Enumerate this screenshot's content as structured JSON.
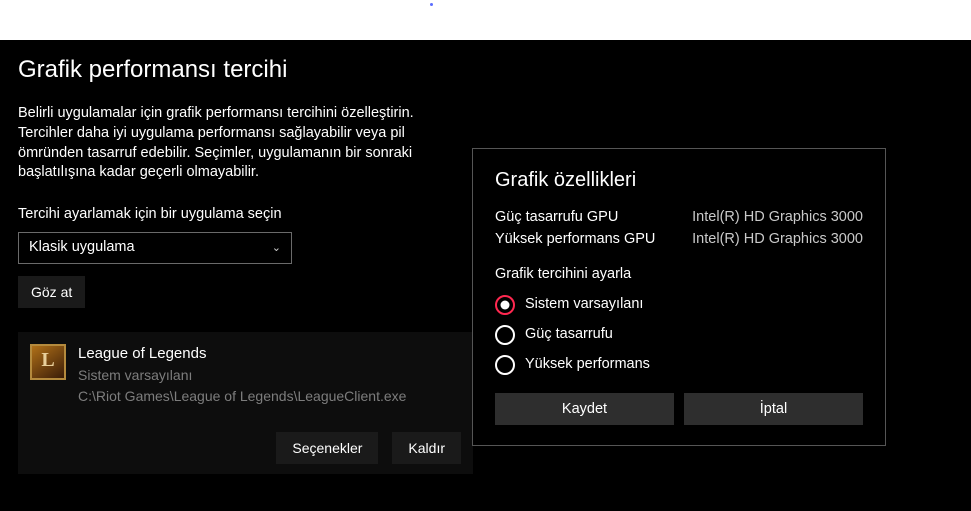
{
  "header": {
    "title": "Grafik performansı tercihi",
    "description": "Belirli uygulamalar için grafik performansı tercihini özelleştirin. Tercihler daha iyi uygulama performansı sağlayabilir veya pil ömründen tasarruf edebilir. Seçimler, uygulamanın bir sonraki başlatılışına kadar geçerli olmayabilir."
  },
  "appSelect": {
    "label": "Tercihi ayarlamak için bir uygulama seçin",
    "value": "Klasik uygulama",
    "browse": "Göz at"
  },
  "app": {
    "name": "League of Legends",
    "pref": "Sistem varsayılanı",
    "path": "C:\\Riot Games\\League of Legends\\LeagueClient.exe",
    "options": "Seçenekler",
    "remove": "Kaldır"
  },
  "panel": {
    "title": "Grafik özellikleri",
    "powerLabel": "Güç tasarrufu GPU",
    "powerValue": "Intel(R) HD Graphics 3000",
    "perfLabel": "Yüksek performans GPU",
    "perfValue": "Intel(R) HD Graphics 3000",
    "prefLabel": "Grafik tercihini ayarla",
    "options": {
      "default": "Sistem varsayılanı",
      "power": "Güç tasarrufu",
      "perf": "Yüksek performans"
    },
    "save": "Kaydet",
    "cancel": "İptal"
  }
}
